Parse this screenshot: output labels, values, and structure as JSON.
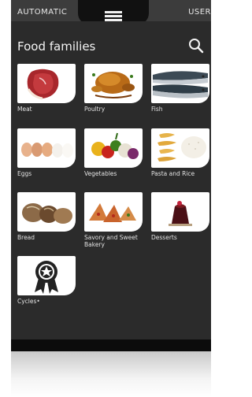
{
  "topbar": {
    "mode_left": "AUTOMATIC",
    "mode_right": "USER",
    "menu_icon": "hamburger-menu-icon"
  },
  "header": {
    "title": "Food families",
    "search_icon": "search-icon"
  },
  "tiles": [
    {
      "label": "Meat",
      "icon": "meat-steak-image"
    },
    {
      "label": "Poultry",
      "icon": "roast-chicken-image"
    },
    {
      "label": "Fish",
      "icon": "fish-image"
    },
    {
      "label": "Eggs",
      "icon": "eggs-image"
    },
    {
      "label": "Vegetables",
      "icon": "vegetables-image"
    },
    {
      "label": "Pasta and Rice",
      "icon": "pasta-rice-image"
    },
    {
      "label": "Bread",
      "icon": "bread-image"
    },
    {
      "label": "Savory and Sweet Bakery",
      "icon": "bakery-image"
    },
    {
      "label": "Desserts",
      "icon": "dessert-image"
    },
    {
      "label": "Cycles•",
      "icon": "award-ribbon-icon"
    }
  ],
  "colors": {
    "panel": "#2b2b2b",
    "topbar": "#3c3c3c",
    "text": "#f4f4f4"
  }
}
